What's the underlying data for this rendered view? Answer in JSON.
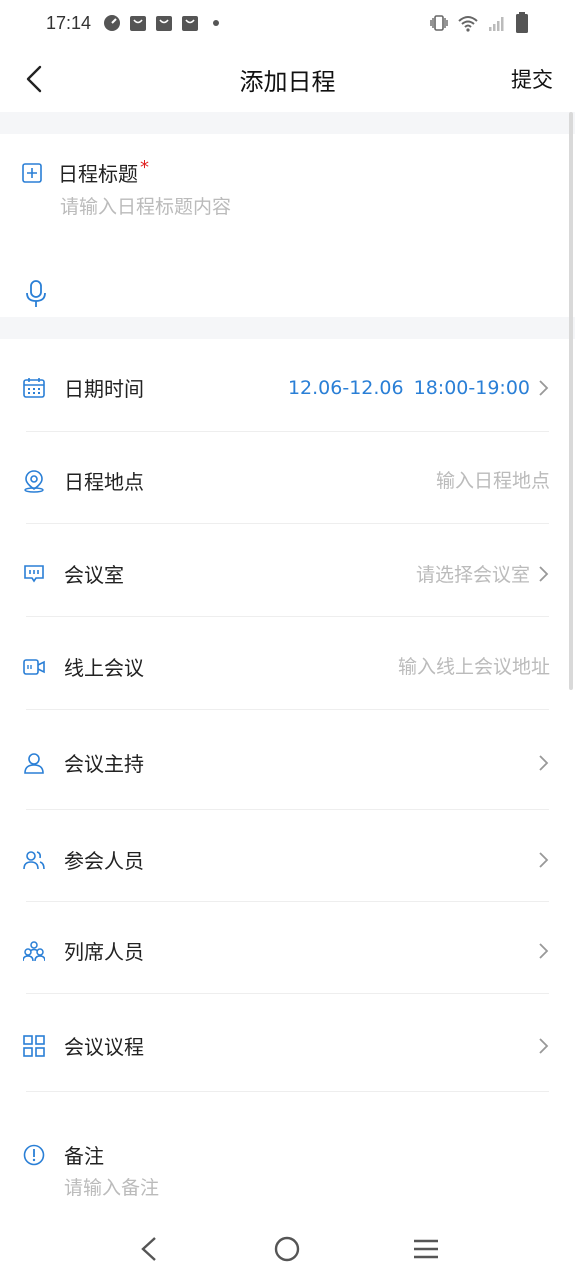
{
  "status_bar": {
    "time": "17:14",
    "left_icons": [
      "speedometer-icon",
      "shopping-bag-icon",
      "shopping-bag-icon",
      "shopping-bag-icon",
      "dot-icon"
    ],
    "right_icons": [
      "vibrate-icon",
      "wifi-icon",
      "signal-icon",
      "battery-icon"
    ]
  },
  "nav": {
    "title": "添加日程",
    "submit_label": "提交"
  },
  "title_section": {
    "label": "日程标题",
    "required_mark": "*",
    "placeholder": "请输入日程标题内容"
  },
  "rows": {
    "datetime": {
      "label": "日期时间",
      "date_range": "12.06-12.06",
      "time_range": "18:00-19:00"
    },
    "location": {
      "label": "日程地点",
      "placeholder": "输入日程地点"
    },
    "meeting_room": {
      "label": "会议室",
      "value": "请选择会议室"
    },
    "online_meeting": {
      "label": "线上会议",
      "placeholder": "输入线上会议地址"
    },
    "host": {
      "label": "会议主持"
    },
    "attendees": {
      "label": "参会人员"
    },
    "observers": {
      "label": "列席人员"
    },
    "agenda": {
      "label": "会议议程"
    },
    "remark": {
      "label": "备注",
      "placeholder": "请输入备注"
    }
  },
  "colors": {
    "accent": "#2a7fd6",
    "placeholder": "#bbbbbb",
    "section_gap": "#f5f6f8",
    "required": "#e02020"
  }
}
